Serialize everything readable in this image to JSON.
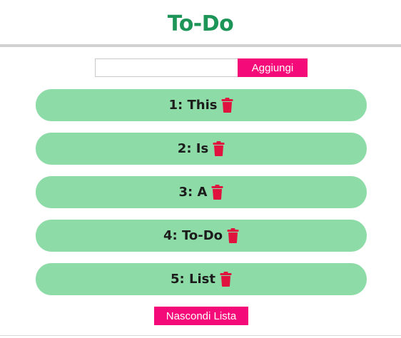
{
  "app": {
    "title": "To-Do"
  },
  "form": {
    "input_value": "",
    "input_placeholder": "",
    "add_label": "Aggiungi"
  },
  "todos": [
    {
      "label": "1: This"
    },
    {
      "label": "2: Is"
    },
    {
      "label": "3: A"
    },
    {
      "label": "4: To-Do"
    },
    {
      "label": "5: List"
    }
  ],
  "icons": {
    "delete": "trash-icon"
  },
  "footer": {
    "toggle_label": "Nascondi Lista"
  },
  "colors": {
    "title": "#1e9558",
    "accent": "#f50a79",
    "item_background": "#8ddba6",
    "trash": "#e0133f"
  }
}
